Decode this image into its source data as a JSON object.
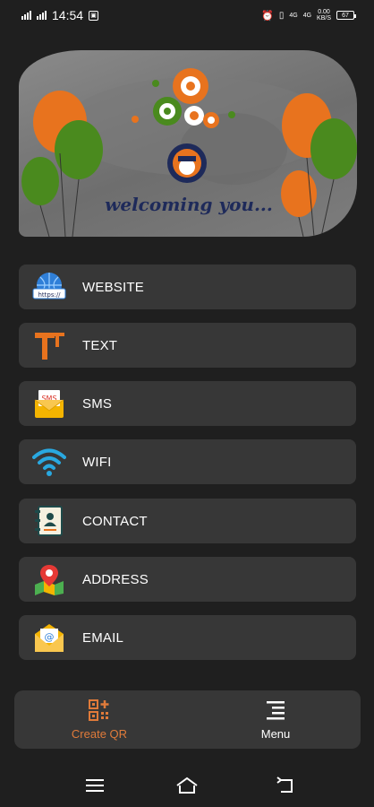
{
  "status_bar": {
    "time": "14:54",
    "network_left": "4G",
    "network_right": "4G",
    "speed": "0.00",
    "speed_unit": "KB/S",
    "battery": "67"
  },
  "banner": {
    "welcome_text": "welcoming you..."
  },
  "menu": {
    "items": [
      {
        "label": "WEBSITE",
        "icon": "globe-https-icon"
      },
      {
        "label": "TEXT",
        "icon": "text-tt-icon"
      },
      {
        "label": "SMS",
        "icon": "sms-envelope-icon"
      },
      {
        "label": "WIFI",
        "icon": "wifi-icon"
      },
      {
        "label": "CONTACT",
        "icon": "contact-book-icon"
      },
      {
        "label": "ADDRESS",
        "icon": "map-pin-icon"
      },
      {
        "label": "EMAIL",
        "icon": "email-envelope-icon"
      }
    ]
  },
  "tabbar": {
    "create_label": "Create QR",
    "menu_label": "Menu",
    "active": "Create QR"
  },
  "colors": {
    "accent": "#e07b3a",
    "background": "#1f1f1f",
    "card": "#373737"
  }
}
